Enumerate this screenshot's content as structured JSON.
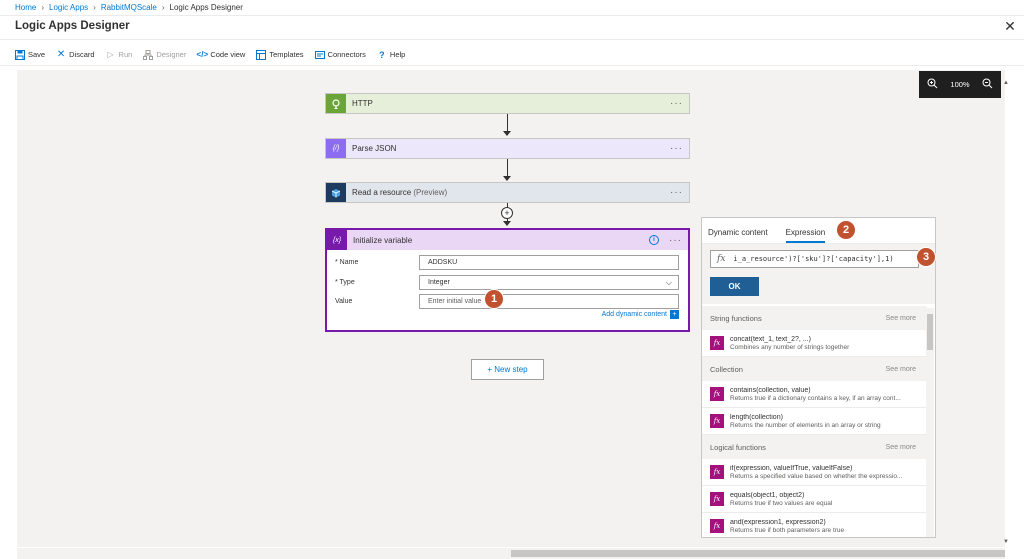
{
  "breadcrumb": {
    "items": [
      "Home",
      "Logic Apps",
      "RabbitMQScale",
      "Logic Apps Designer"
    ]
  },
  "title": "Logic Apps Designer",
  "toolbar": {
    "save": "Save",
    "discard": "Discard",
    "run": "Run",
    "designer": "Designer",
    "code_view": "Code view",
    "templates": "Templates",
    "connectors": "Connectors",
    "help": "Help"
  },
  "zoom": {
    "level": "100%"
  },
  "steps": [
    {
      "title": "HTTP",
      "color": "#6ba539"
    },
    {
      "title": "Parse JSON",
      "color": "#8c6cf0"
    },
    {
      "title": "Read a resource",
      "suffix": "(Preview)",
      "color": "#1f3a5f"
    }
  ],
  "init_variable": {
    "title": "Initialize variable",
    "fields": {
      "name_label": "* Name",
      "name_value": "ADDSKU",
      "type_label": "* Type",
      "type_value": "Integer",
      "value_label": "Value",
      "value_placeholder": "Enter initial value"
    },
    "add_dynamic": "Add dynamic content"
  },
  "new_step": "+ New step",
  "badges": [
    "1",
    "2",
    "3"
  ],
  "panel": {
    "tabs": [
      "Dynamic content",
      "Expression"
    ],
    "expression": "i_a_resource')?['sku']?['capacity'],1)",
    "ok": "OK",
    "see_more": "See more",
    "sections": [
      {
        "name": "String functions",
        "items": [
          {
            "name": "concat(text_1, text_2?, ...)",
            "desc": "Combines any number of strings together"
          }
        ]
      },
      {
        "name": "Collection",
        "items": [
          {
            "name": "contains(collection, value)",
            "desc": "Returns true if a dictionary contains a key, if an array cont..."
          },
          {
            "name": "length(collection)",
            "desc": "Returns the number of elements in an array or string"
          }
        ]
      },
      {
        "name": "Logical functions",
        "items": [
          {
            "name": "if(expression, valueIfTrue, valueIfFalse)",
            "desc": "Returns a specified value based on whether the expressio..."
          },
          {
            "name": "equals(object1, object2)",
            "desc": "Returns true if two values are equal"
          },
          {
            "name": "and(expression1, expression2)",
            "desc": "Returns true if both parameters are true"
          }
        ]
      }
    ]
  },
  "colors": {
    "accent": "#0078d4",
    "variable": "#7719aa",
    "badge": "#c0522f",
    "function": "#a4107c"
  }
}
